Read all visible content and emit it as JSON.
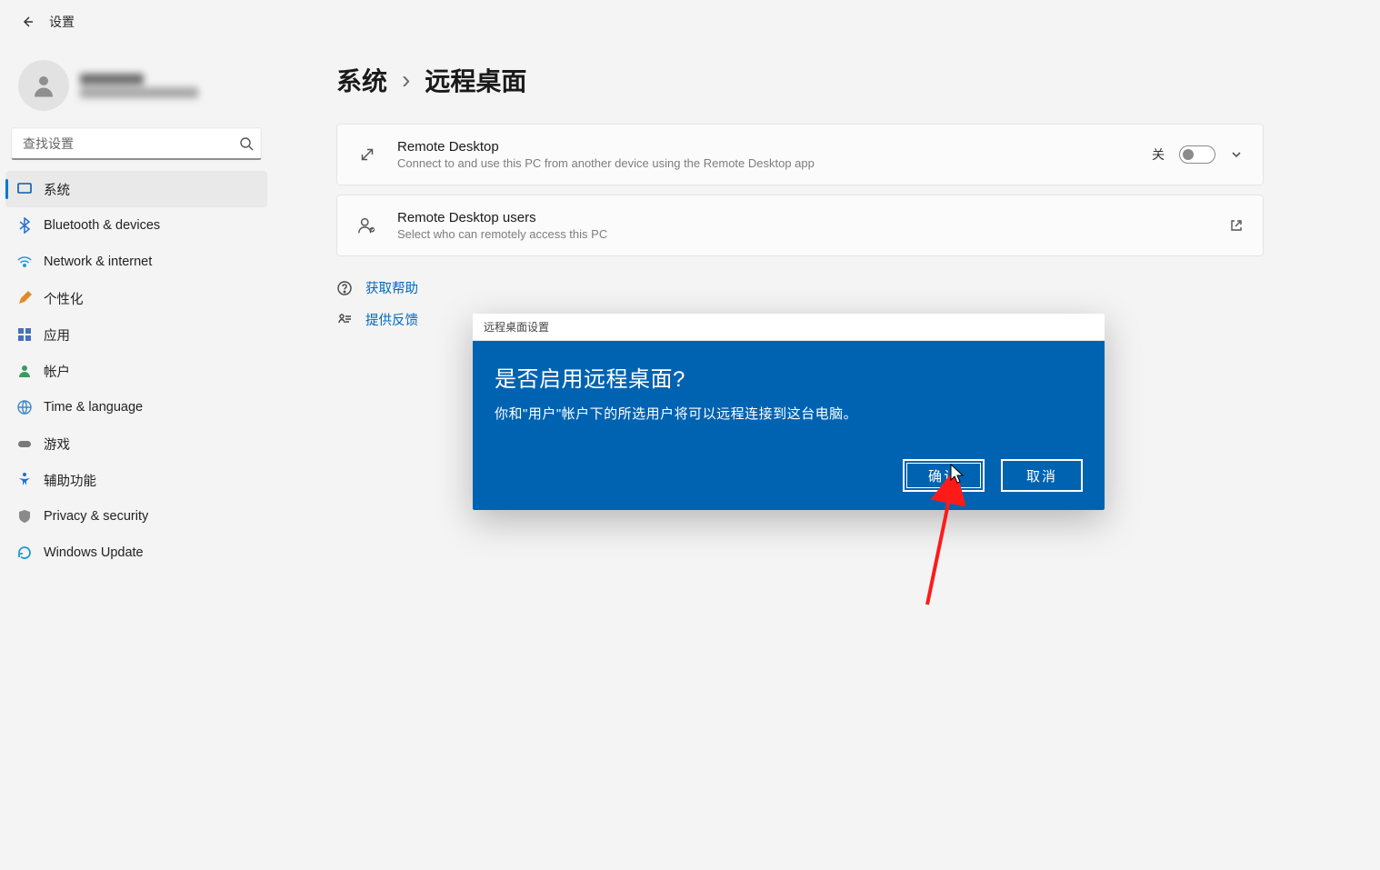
{
  "app_title": "设置",
  "search": {
    "placeholder": "查找设置"
  },
  "sidebar": {
    "items": [
      {
        "label": "系统",
        "icon": "system"
      },
      {
        "label": "Bluetooth & devices",
        "icon": "bluetooth"
      },
      {
        "label": "Network & internet",
        "icon": "wifi"
      },
      {
        "label": "个性化",
        "icon": "pencil"
      },
      {
        "label": "应用",
        "icon": "apps"
      },
      {
        "label": "帐户",
        "icon": "person"
      },
      {
        "label": "Time & language",
        "icon": "globe"
      },
      {
        "label": "游戏",
        "icon": "gamepad"
      },
      {
        "label": "辅助功能",
        "icon": "accessibility"
      },
      {
        "label": "Privacy & security",
        "icon": "shield"
      },
      {
        "label": "Windows Update",
        "icon": "update"
      }
    ]
  },
  "breadcrumb": {
    "parent": "系统",
    "current": "远程桌面"
  },
  "cards": {
    "remote_desktop": {
      "title": "Remote Desktop",
      "sub": "Connect to and use this PC from another device using the Remote Desktop app",
      "toggle_label": "关"
    },
    "rd_users": {
      "title": "Remote Desktop users",
      "sub": "Select who can remotely access this PC"
    }
  },
  "links": {
    "help": "获取帮助",
    "feedback": "提供反馈"
  },
  "dialog": {
    "window_title": "远程桌面设置",
    "title": "是否启用远程桌面?",
    "body": "你和\"用户\"帐户下的所选用户将可以远程连接到这台电脑。",
    "confirm": "确认",
    "cancel": "取消"
  }
}
